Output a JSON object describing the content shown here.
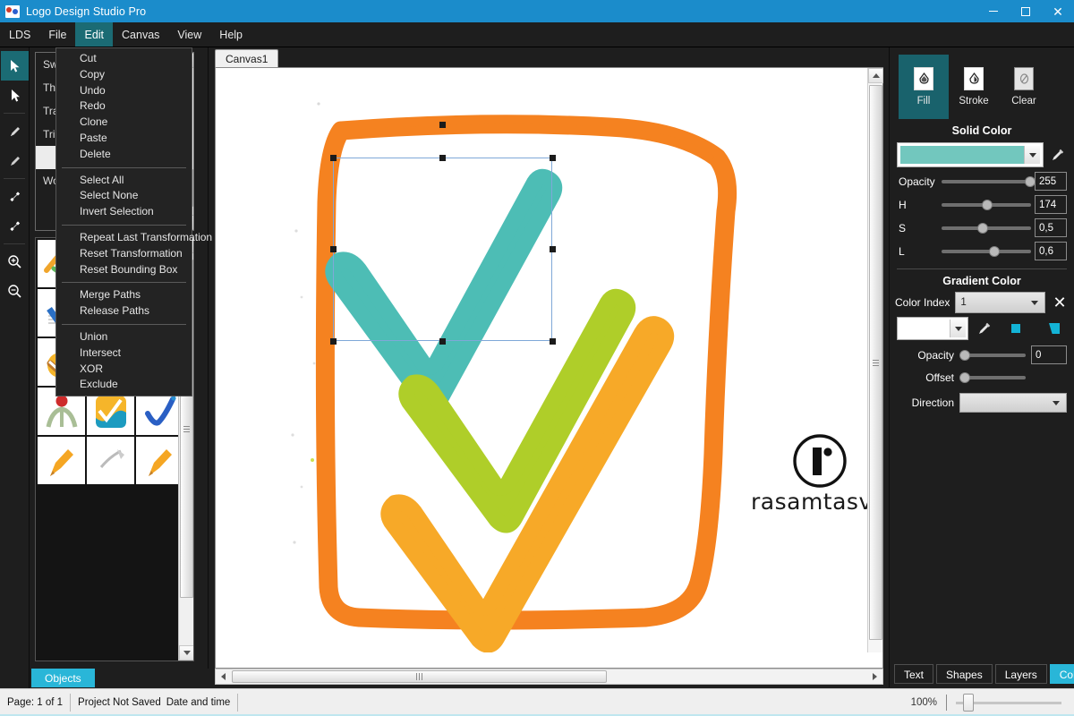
{
  "window": {
    "title": "Logo Design Studio Pro",
    "app_icon": "app-logo-icon",
    "minimize": "minimize-icon",
    "maximize": "maximize-icon",
    "close": "close-icon"
  },
  "menubar": {
    "items": [
      {
        "label": "LDS",
        "active": false
      },
      {
        "label": "File",
        "active": false
      },
      {
        "label": "Edit",
        "active": true
      },
      {
        "label": "Canvas",
        "active": false
      },
      {
        "label": "View",
        "active": false
      },
      {
        "label": "Help",
        "active": false
      }
    ]
  },
  "edit_menu": {
    "open": true,
    "groups": [
      [
        "Cut",
        "Copy",
        "Undo",
        "Redo",
        "Clone",
        "Paste",
        "Delete"
      ],
      [
        "Select All",
        "Select None",
        "Invert Selection"
      ],
      [
        "Repeat Last Transformation",
        "Reset Transformation",
        "Reset Bounding Box"
      ],
      [
        "Merge Paths",
        "Release Paths"
      ],
      [
        "Union",
        "Intersect",
        "XOR",
        "Exclude"
      ]
    ]
  },
  "toolbar": {
    "tools": [
      {
        "name": "select-arrow-tool",
        "selected": true
      },
      {
        "name": "direct-select-tool",
        "selected": false
      },
      {
        "name": "pen-tool",
        "selected": false
      },
      {
        "name": "pencil-tool",
        "selected": false
      },
      {
        "name": "add-node-tool",
        "selected": false
      },
      {
        "name": "remove-node-tool",
        "selected": false
      },
      {
        "name": "zoom-in-tool",
        "selected": false
      },
      {
        "name": "zoom-out-tool",
        "selected": false
      }
    ]
  },
  "left_panel": {
    "list_items": [
      {
        "label": "Swo",
        "selected": false
      },
      {
        "label": "Thin",
        "selected": false
      },
      {
        "label": "Tran",
        "selected": false
      },
      {
        "label": "Trial",
        "selected": false
      },
      {
        "label": "",
        "selected": true
      },
      {
        "label": "Wor",
        "selected": false
      }
    ],
    "objects_tab": "Objects"
  },
  "canvas": {
    "tab_label": "Canvas1",
    "watermark_text": "rasamtasvir",
    "artwork": {
      "border_color": "#F58220",
      "check_colors": [
        "#4DBDB5",
        "#AFCE29",
        "#F7A928"
      ]
    },
    "selection": {
      "handles": 8,
      "color": "#7FA8D8"
    }
  },
  "color_panel": {
    "mode_buttons": [
      {
        "label": "Fill",
        "icon": "fill-bucket-icon",
        "active": true
      },
      {
        "label": "Stroke",
        "icon": "stroke-bucket-icon",
        "active": false
      },
      {
        "label": "Clear",
        "icon": "clear-none-icon",
        "active": false
      }
    ],
    "solid": {
      "title": "Solid Color",
      "swatch_color": "#72C7BE",
      "picker_icon": "eyedropper-icon",
      "sliders": [
        {
          "label": "Opacity",
          "value": "255",
          "pct": 96
        },
        {
          "label": "H",
          "value": "174",
          "pct": 48
        },
        {
          "label": "S",
          "value": "0,5",
          "pct": 44
        },
        {
          "label": "L",
          "value": "0,6",
          "pct": 56
        }
      ]
    },
    "gradient": {
      "title": "Gradient Color",
      "color_index_label": "Color Index",
      "color_index_value": "1",
      "delete_icon": "close-x-icon",
      "swatch_color": "#FFFFFF",
      "picker_icon": "eyedropper-icon",
      "marker_icon_1": "gradient-stop-icon",
      "marker_icon_2": "gradient-stop-corner-icon",
      "opacity_label": "Opacity",
      "opacity_value": "0",
      "opacity_pct": 0,
      "offset_label": "Offset",
      "offset_pct": 0,
      "direction_label": "Direction",
      "direction_value": ""
    },
    "tabs": [
      {
        "label": "Text",
        "active": false
      },
      {
        "label": "Shapes",
        "active": false
      },
      {
        "label": "Layers",
        "active": false
      },
      {
        "label": "Color",
        "active": true
      }
    ]
  },
  "statusbar": {
    "page": "Page: 1 of 1",
    "save_state": "Project Not Saved",
    "datetime": "Date and time",
    "zoom": "100%"
  },
  "colors": {
    "title_bar": "#1B8CCB",
    "accent": "#29B6D8",
    "panel_bg": "#1E1E1E",
    "active_tool": "#1B6B74"
  }
}
